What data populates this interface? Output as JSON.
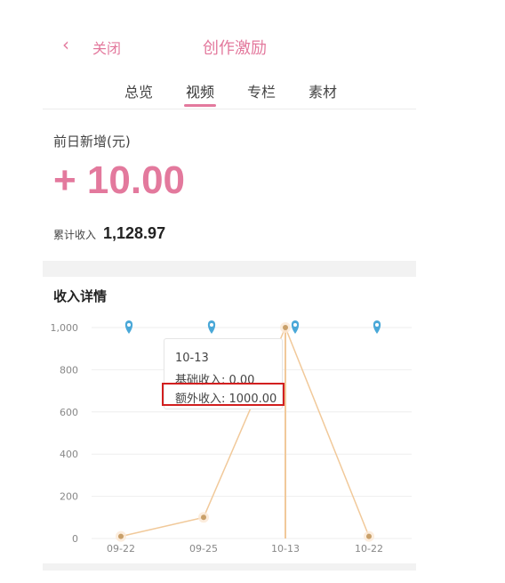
{
  "header": {
    "back_icon": "chevron-left-icon",
    "close_label": "关闭",
    "title": "创作激励"
  },
  "tabs": [
    {
      "label": "总览"
    },
    {
      "label": "视频",
      "active": true
    },
    {
      "label": "专栏"
    },
    {
      "label": "素材"
    }
  ],
  "summary": {
    "daily_label": "前日新增(元)",
    "daily_value": "+ 10.00",
    "total_label": "累计收入",
    "total_value": "1,128.97"
  },
  "section": {
    "title": "收入详情"
  },
  "tooltip": {
    "date": "10-13",
    "base": "基础收入: 0.00",
    "extra": "额外收入: 1000.00"
  },
  "colors": {
    "accent": "#e3799d",
    "line": "#f1c99a",
    "marker": "#4aa8d8",
    "highlight": "#d21f1f"
  },
  "chart_data": {
    "type": "line",
    "categories": [
      "09-22",
      "09-25",
      "10-13",
      "10-22"
    ],
    "y_tick_labels": [
      "0",
      "200",
      "400",
      "600",
      "800",
      "1,000"
    ],
    "series": [
      {
        "values": [
          10,
          100,
          1000,
          10
        ]
      }
    ],
    "ylim": [
      0,
      1000
    ],
    "grid": true
  }
}
